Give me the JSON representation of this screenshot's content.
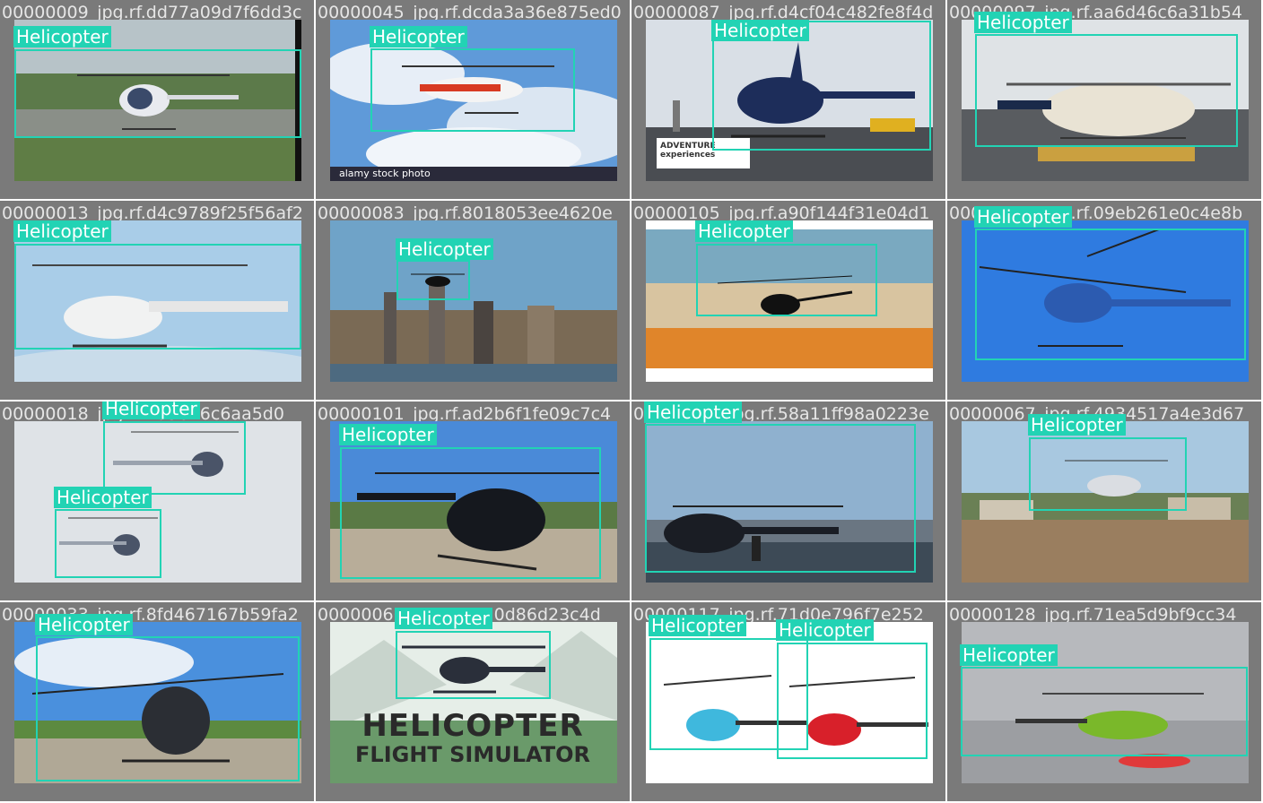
{
  "colors": {
    "box": "#22d3b4",
    "label_text": "#ffffff",
    "background": "#7a7a7a"
  },
  "cells": [
    {
      "filename": "00000009_jpg.rf.dd77a09d7f6dd3c",
      "labels": [
        "Helicopter"
      ]
    },
    {
      "filename": "00000045_jpg.rf.dcda3a36e875ed0",
      "labels": [
        "Helicopter"
      ],
      "watermark": "alamy stock photo"
    },
    {
      "filename": "00000087_jpg.rf.d4cf04c482fe8f4d",
      "labels": [
        "Helicopter"
      ],
      "logo": "ADVENTURE experiences"
    },
    {
      "filename": "00000097_jpg.rf.aa6d46c6a31b54",
      "labels": [
        "Helicopter"
      ]
    },
    {
      "filename": "00000013_jpg.rf.d4c9789f25f56af2",
      "labels": [
        "Helicopter"
      ]
    },
    {
      "filename": "00000083_jpg.rf.8018053ee4620e",
      "labels": [
        "Helicopter"
      ]
    },
    {
      "filename": "00000105_jpg.rf.a90f144f31e04d1",
      "labels": [
        "Helicopter"
      ]
    },
    {
      "filename": "00000057_jpg.rf.09eb261e0c4e8b",
      "labels": [
        "Helicopter"
      ]
    },
    {
      "filename": "00000018_jpg.rf.7a9616c6aa5d0",
      "labels": [
        "Helicopter",
        "Helicopter"
      ]
    },
    {
      "filename": "00000101_jpg.rf.ad2b6f1fe09c7c4",
      "labels": [
        "Helicopter"
      ]
    },
    {
      "filename": "00000081_jpg.rf.58a11ff98a0223e",
      "labels": [
        "Helicopter"
      ]
    },
    {
      "filename": "00000067_jpg.rf.4934517a4e3d67",
      "labels": [
        "Helicopter"
      ]
    },
    {
      "filename": "00000033_jpg.rf.8fd467167b59fa2",
      "labels": [
        "Helicopter"
      ]
    },
    {
      "filename": "00000066_jpg.rf.a910d86d23c4d",
      "labels": [
        "Helicopter"
      ],
      "sim_title": [
        "HELICOPTER",
        "FLIGHT SIMULATOR"
      ]
    },
    {
      "filename": "00000117_jpg.rf.71d0e796f7e252",
      "labels": [
        "Helicopter",
        "Helicopter"
      ]
    },
    {
      "filename": "00000128_jpg.rf.71ea5d9bf9cc34",
      "labels": [
        "Helicopter"
      ]
    }
  ]
}
